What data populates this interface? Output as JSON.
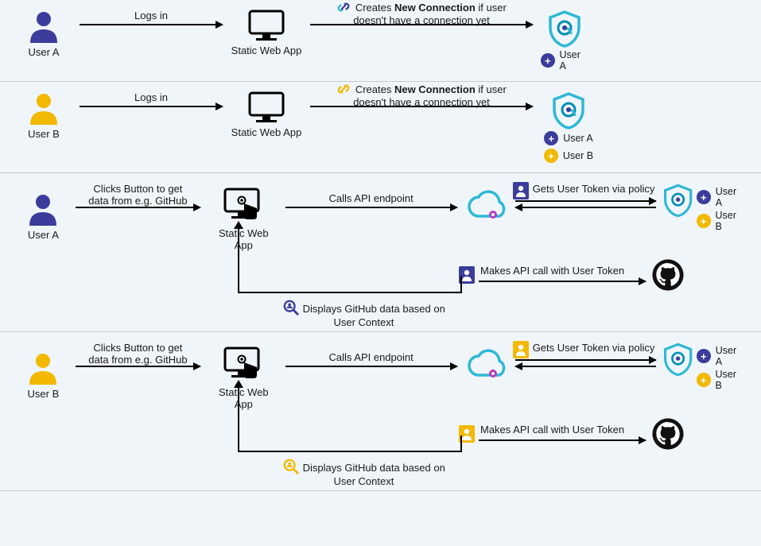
{
  "colors": {
    "purple": "#3b3c9b",
    "yellow": "#f2b900",
    "cyan": "#2eb8d6",
    "darkcyan": "#008fb3",
    "pink": "#b63bc1"
  },
  "labels": {
    "userA": "User A",
    "userB": "User B",
    "staticWebApp": "Static Web App",
    "logsIn": "Logs in",
    "newConnPrefix": "Creates ",
    "newConnBold": "New Connection",
    "newConnSuffix": " if user",
    "newConnLine2": "doesn't have a connection yet",
    "clicksButton": "Clicks Button to get",
    "clicksButton2": "data from e.g. GitHub",
    "callsApi": "Calls API endpoint",
    "getsToken": "Gets User Token via policy",
    "makesApiCall": "Makes API call with User Token",
    "displaysGithub": "Displays GitHub data based on",
    "displaysGithub2": "User Context"
  }
}
